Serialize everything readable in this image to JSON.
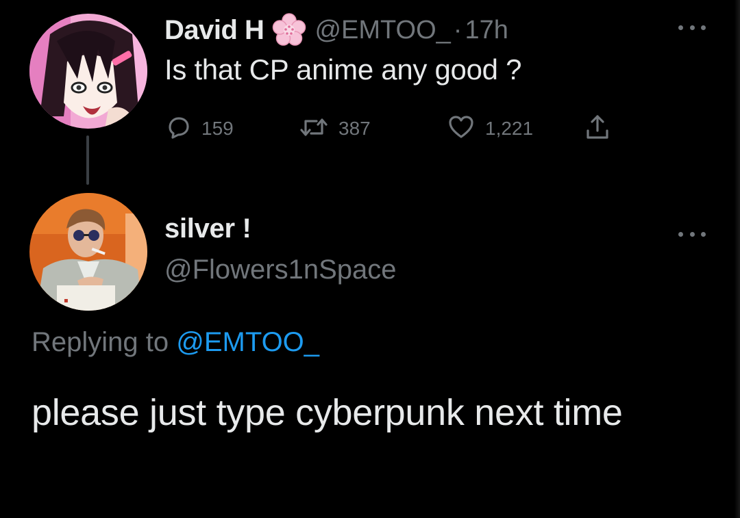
{
  "parent_tweet": {
    "display_name": "David H",
    "name_emoji": "cherry-blossom-icon",
    "handle": "@EMTOO_",
    "separator": "·",
    "time": "17h",
    "text": "Is that CP anime any good ?",
    "actions": {
      "reply_count": "159",
      "retweet_count": "387",
      "like_count": "1,221"
    }
  },
  "reply_tweet": {
    "display_name": "silver !",
    "handle": "@Flowers1nSpace",
    "replying_to_label": "Replying to",
    "replying_to_handle": "@EMTOO_",
    "text": "please just type cyberpunk next time"
  },
  "colors": {
    "background": "#000000",
    "primary_text": "#e7e9ea",
    "secondary_text": "#71767b",
    "link": "#1d9bf0",
    "thread_line": "#3a3f44"
  }
}
